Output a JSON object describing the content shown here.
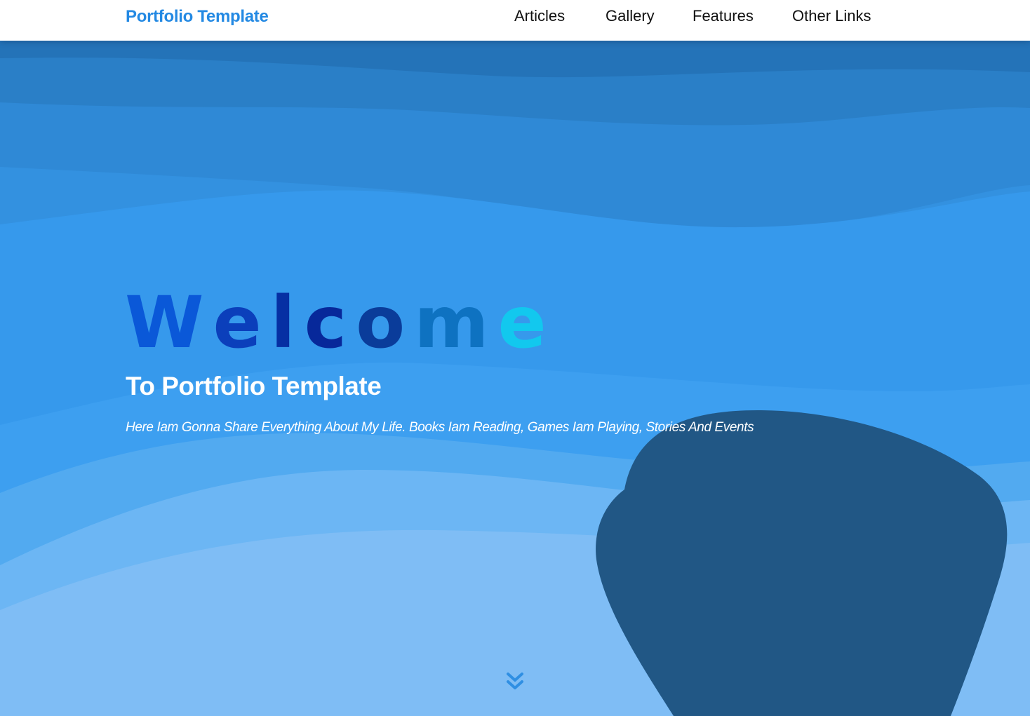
{
  "navbar": {
    "brand": "Portfolio Template",
    "links": [
      {
        "label": "Articles"
      },
      {
        "label": "Gallery"
      },
      {
        "label": "Features"
      },
      {
        "label": "Other Links"
      }
    ]
  },
  "hero": {
    "welcome_letters": [
      "W",
      "e",
      "l",
      "c",
      "o",
      "m",
      "e"
    ],
    "subtitle": "To Portfolio Template",
    "tagline": "Here Iam Gonna Share Everything About My Life. Books Iam Reading, Games Iam Playing, Stories And Events",
    "scroll_icon": "double-chevron-down-icon"
  },
  "colors": {
    "brand": "#2389e3",
    "nav_background": "#ffffff",
    "nav_text": "#111111",
    "hero_text": "#ffffff",
    "wave_dark": "#2473b8",
    "wave_mid": "#3699ec",
    "wave_light": "#7fbdf5",
    "blob": "#215785",
    "welcome_letters": [
      "#0a58d8",
      "#0b3fbb",
      "#062fa3",
      "#07289a",
      "#0a3c9a",
      "#0e72c1",
      "#12c8ee"
    ]
  }
}
